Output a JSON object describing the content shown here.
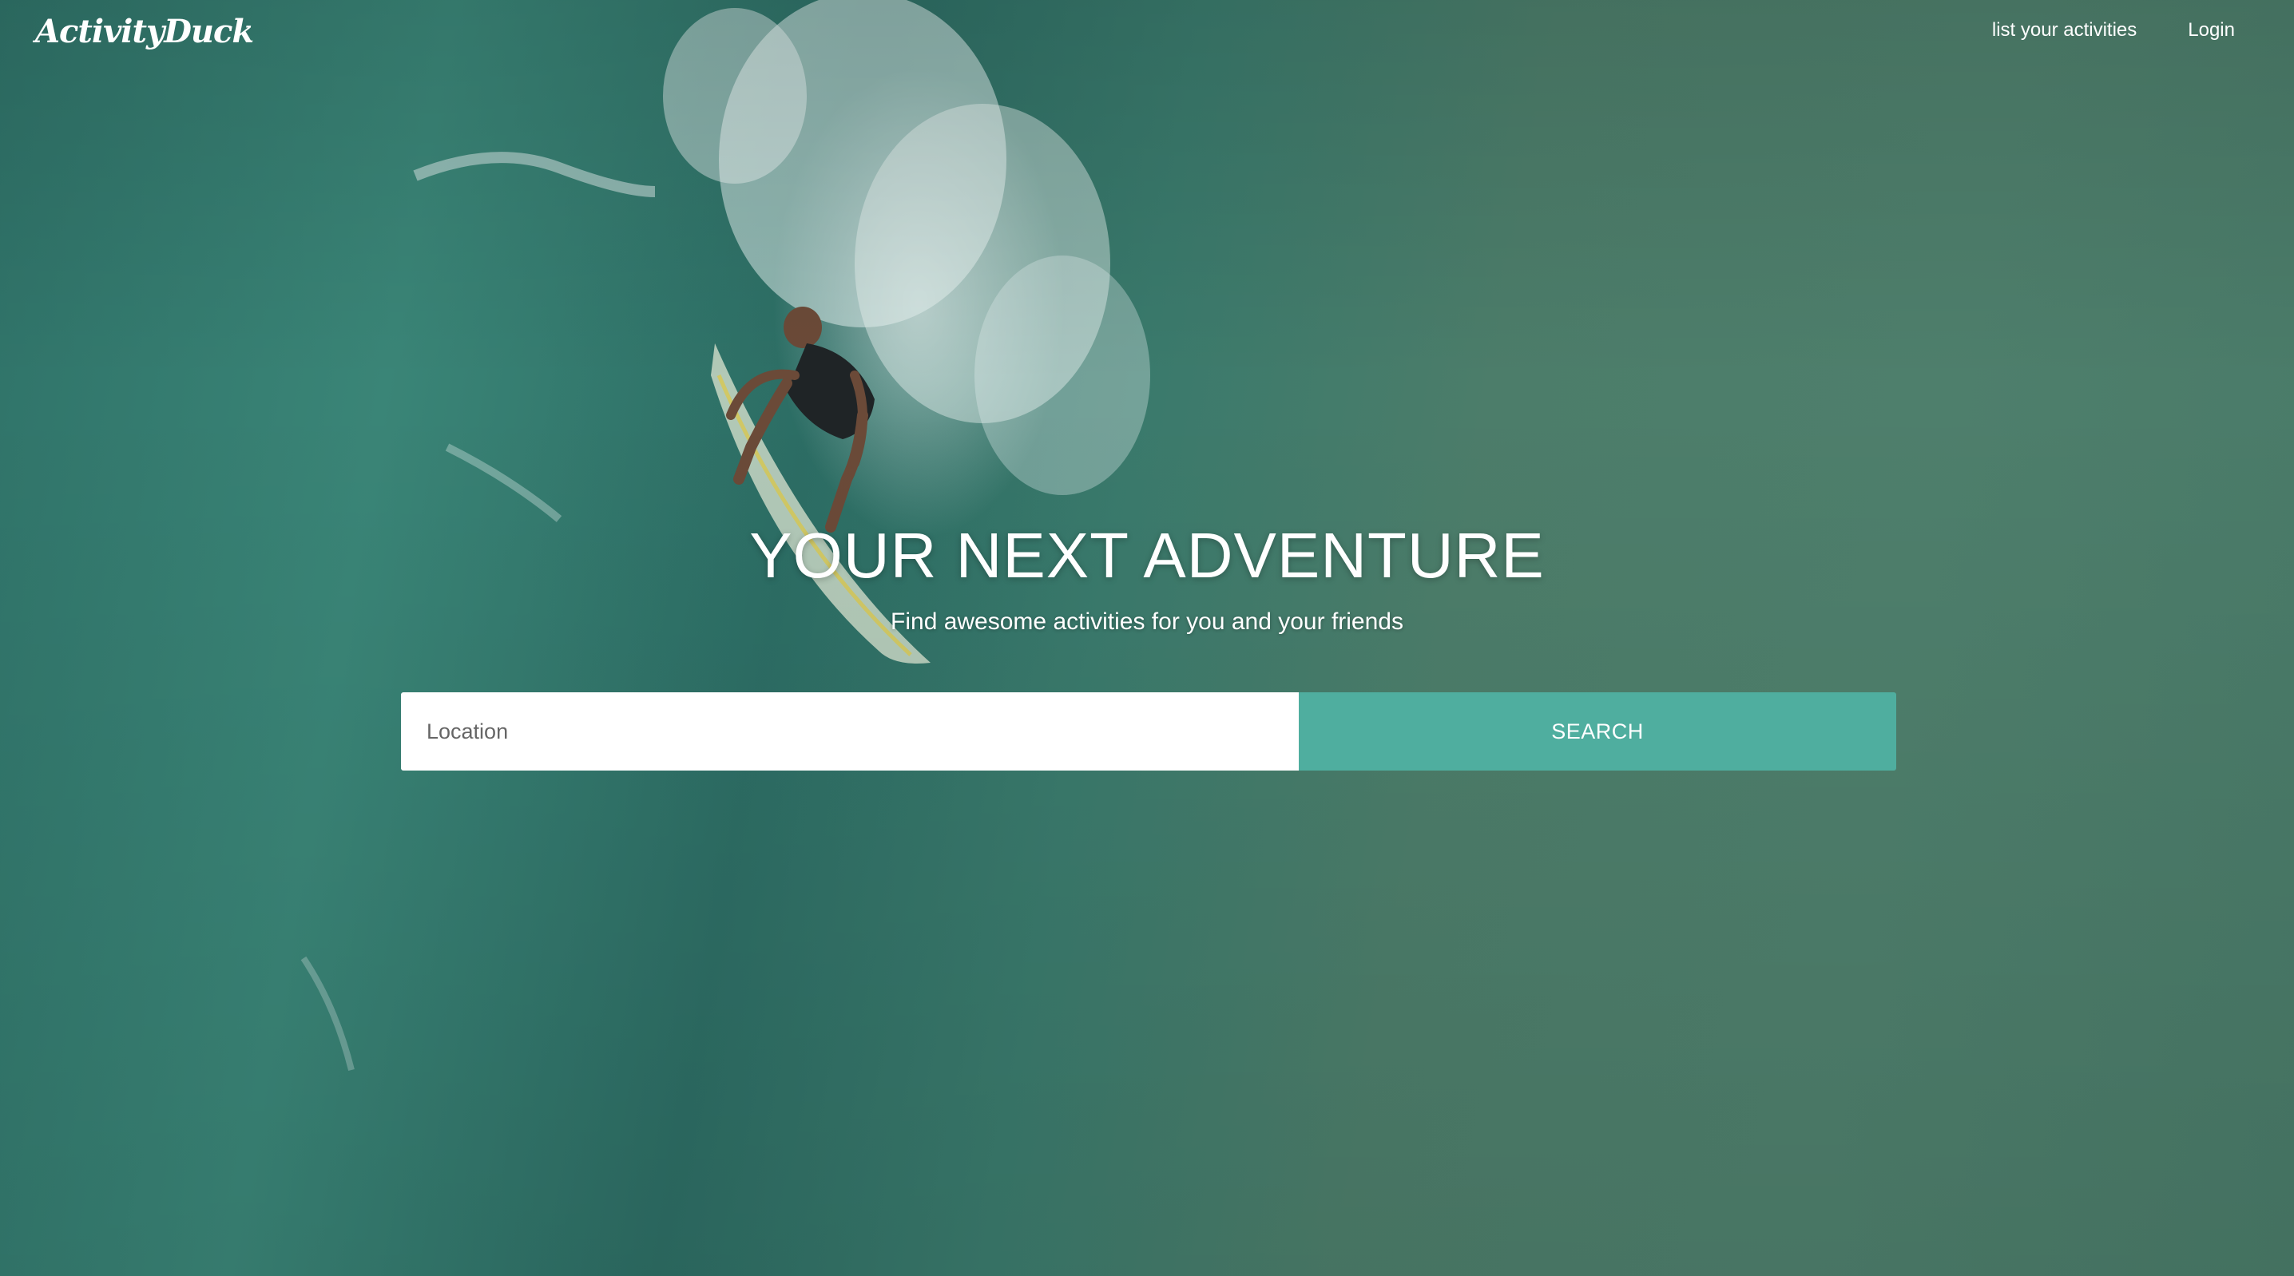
{
  "header": {
    "logo": "ActivityDuck",
    "nav": [
      "list your activities",
      "Login"
    ]
  },
  "hero": {
    "title": "YOUR NEXT ADVENTURE",
    "subtitle": "Find awesome activities for you and your friends"
  },
  "search": {
    "placeholder": "Location",
    "button_label": "SEARCH"
  },
  "colors": {
    "accent": "#4fae9f",
    "text": "#ffffff"
  }
}
